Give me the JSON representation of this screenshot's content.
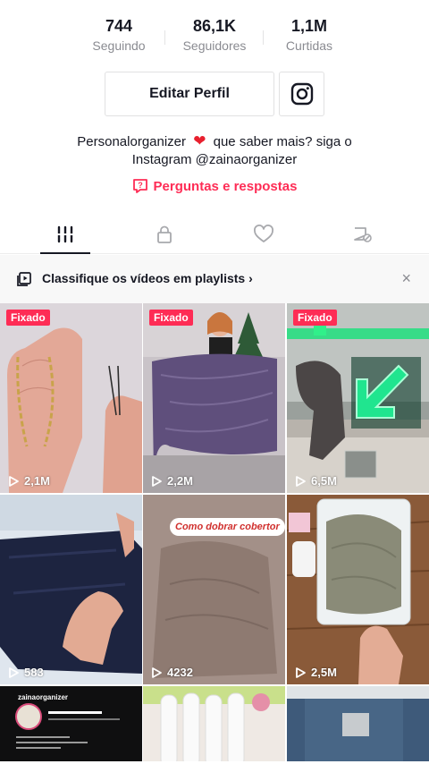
{
  "stats": [
    {
      "value": "744",
      "label": "Seguindo"
    },
    {
      "value": "86,1K",
      "label": "Seguidores"
    },
    {
      "value": "1,1M",
      "label": "Curtidas"
    }
  ],
  "profile": {
    "edit_label": "Editar Perfil",
    "bio_line1_a": "Personalorganizer",
    "bio_line1_b": "que saber mais? siga o",
    "bio_line2": "Instagram @zainaorganizer",
    "qa_label": "Perguntas e respostas"
  },
  "tabs": [
    {
      "icon": "grid-icon",
      "active": true
    },
    {
      "icon": "lock-icon",
      "active": false
    },
    {
      "icon": "heart-icon",
      "active": false
    },
    {
      "icon": "tagged-icon",
      "active": false
    }
  ],
  "playlist_banner": {
    "text": "Classifique os vídeos em playlists",
    "close": "×"
  },
  "videos": [
    {
      "pinned": "Fixado",
      "views": "2,1M"
    },
    {
      "pinned": "Fixado",
      "views": "2,2M"
    },
    {
      "pinned": "Fixado",
      "views": "6,5M"
    },
    {
      "views": "583"
    },
    {
      "views": "4232",
      "caption": "Como dobrar cobertor"
    },
    {
      "views": "2,5M"
    },
    {
      "mini_name": "zainaorganizer"
    }
  ],
  "colors": {
    "accent": "#fe2c55",
    "text": "#161823",
    "muted": "#8a8b91"
  }
}
